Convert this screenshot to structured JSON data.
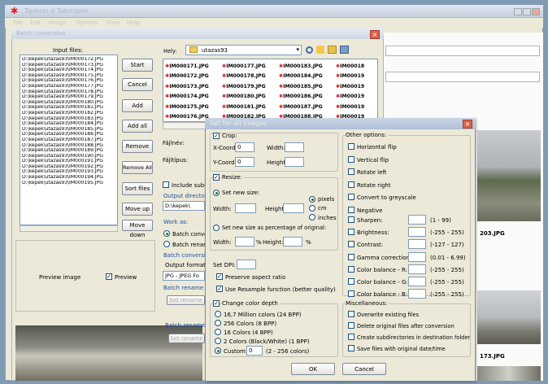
{
  "window": {
    "title": "Tiplerin ir Tokrrosim",
    "menu": [
      "File",
      "Edit",
      "Image",
      "Options",
      "View",
      "Help"
    ]
  },
  "batch": {
    "title": "Batch conversion",
    "input_files_label": "Input files:",
    "files": [
      "D:\\kepek\\utazas93\\IM000172.JPG",
      "D:\\kepek\\utazas93\\IM000173.JPG",
      "D:\\kepek\\utazas93\\IM000174.JPG",
      "D:\\kepek\\utazas93\\IM000175.JPG",
      "D:\\kepek\\utazas93\\IM000176.JPG",
      "D:\\kepek\\utazas93\\IM000177.JPG",
      "D:\\kepek\\utazas93\\IM000178.JPG",
      "D:\\kepek\\utazas93\\IM000179.JPG",
      "D:\\kepek\\utazas93\\IM000180.JPG",
      "D:\\kepek\\utazas93\\IM000181.JPG",
      "D:\\kepek\\utazas93\\IM000182.JPG",
      "D:\\kepek\\utazas93\\IM000183.JPG",
      "D:\\kepek\\utazas93\\IM000184.JPG",
      "D:\\kepek\\utazas93\\IM000185.JPG",
      "D:\\kepek\\utazas93\\IM000186.JPG",
      "D:\\kepek\\utazas93\\IM000187.JPG",
      "D:\\kepek\\utazas93\\IM000188.JPG",
      "D:\\kepek\\utazas93\\IM000189.JPG",
      "D:\\kepek\\utazas93\\IM000190.JPG",
      "D:\\kepek\\utazas93\\IM000191.JPG",
      "D:\\kepek\\utazas93\\IM000192.JPG",
      "D:\\kepek\\utazas93\\IM000193.JPG",
      "D:\\kepek\\utazas93\\IM000194.JPG",
      "D:\\kepek\\utazas93\\IM000195.JPG"
    ],
    "buttons": {
      "start": "Start",
      "cancel": "Cancel",
      "add": "Add",
      "add_all": "Add all",
      "remove": "Remove",
      "remove_all": "Remove All",
      "sort": "Sort files",
      "up": "Move up",
      "down": "Move down"
    },
    "look_in_label": "Hely:",
    "folder": "utazas93",
    "thumbs": [
      [
        "IM000171.JPG",
        "IM000177.JPG",
        "IM000183.JPG",
        "IM00018"
      ],
      [
        "IM000172.JPG",
        "IM000178.JPG",
        "IM000184.JPG",
        "IM00019"
      ],
      [
        "IM000173.JPG",
        "IM000179.JPG",
        "IM000185.JPG",
        "IM00019"
      ],
      [
        "IM000174.JPG",
        "IM000180.JPG",
        "IM000186.JPG",
        "IM00019"
      ],
      [
        "IM000175.JPG",
        "IM000181.JPG",
        "IM000187.JPG",
        "IM00019"
      ],
      [
        "IM000176.JPG",
        "IM000182.JPG",
        "IM000188.JPG",
        "IM00019"
      ]
    ],
    "filename_label": "Fájlnév:",
    "filetype_label": "Fájltípus:",
    "dir_value": "D:\\kepek\\",
    "include_sub": "Include subdi",
    "output_dir": "Output directory",
    "work_as": "Work as:",
    "batch_conv": "Batch conver",
    "batch_rename": "Batch renam",
    "batch_conv_settings": "Batch conversion",
    "output_format": "Output format:",
    "format_value": "JPG - JPEG Fo",
    "rename_settings": "Batch rename se",
    "set_rename": "Set rename",
    "rename_result": "Batch rename r",
    "set_rename2": "Set rename",
    "preview_image": "Preview image",
    "preview_cb": "Preview"
  },
  "dlg": {
    "title": "Set for all images",
    "crop": "Crop:",
    "xcoord": "X-Coord.:",
    "xval": "0",
    "width": "Width:",
    "ycoord": "Y-Coord.:",
    "yval": "0",
    "height": "Height:",
    "resize": "Resize:",
    "set_new_size": "Set new size:",
    "r_width": "Width:",
    "r_height": "Height:",
    "pixels": "pixels",
    "cm": "cm",
    "inches": "inches",
    "set_percent": "Set new size as percentage of original:",
    "p_width": "Width:",
    "p_height": "Height:",
    "percent": "%",
    "set_dpi": "Set DPI:",
    "preserve": "Preserve aspect ratio",
    "resample": "Use Resample function (better quality)",
    "change_depth": "Change color depth",
    "depths": [
      "16,7 Million colors (24 BPP)",
      "256 Colors (8 BPP)",
      "16 Colors (4 BPP)",
      "2 Colors (Black/White) (1 BPP)"
    ],
    "custom": "Custom:",
    "custom_val": "0",
    "custom_range": "(2 - 256 colors)",
    "other": "Other options:",
    "opts": [
      "Horizontal flip",
      "Vertical flip",
      "Rotate left",
      "Rotate right",
      "Convert to greyscale",
      "Negative"
    ],
    "adjust": [
      {
        "label": "Sharpen:",
        "range": "(1 - 99)"
      },
      {
        "label": "Brightness:",
        "range": "(-255 - 255)"
      },
      {
        "label": "Contrast:",
        "range": "(-127 - 127)"
      },
      {
        "label": "Gamma correction:",
        "range": "(0.01 - 6.99)"
      },
      {
        "label": "Color balance - R:",
        "range": "(-255 - 255)"
      },
      {
        "label": "Color balance - G:",
        "range": "(-255 - 255)"
      },
      {
        "label": "Color balance - B:",
        "range": "(-255 - 255)"
      }
    ],
    "misc": "Miscellaneous:",
    "misc_opts": [
      "Overwrite existing files",
      "Delete original files after conversion",
      "Create subdirectories in destination folder",
      "Save files with original date/time"
    ],
    "ok": "OK",
    "cancel": "Cancel"
  },
  "right": {
    "label1": "203.JPG",
    "label2": "173.JPG"
  }
}
